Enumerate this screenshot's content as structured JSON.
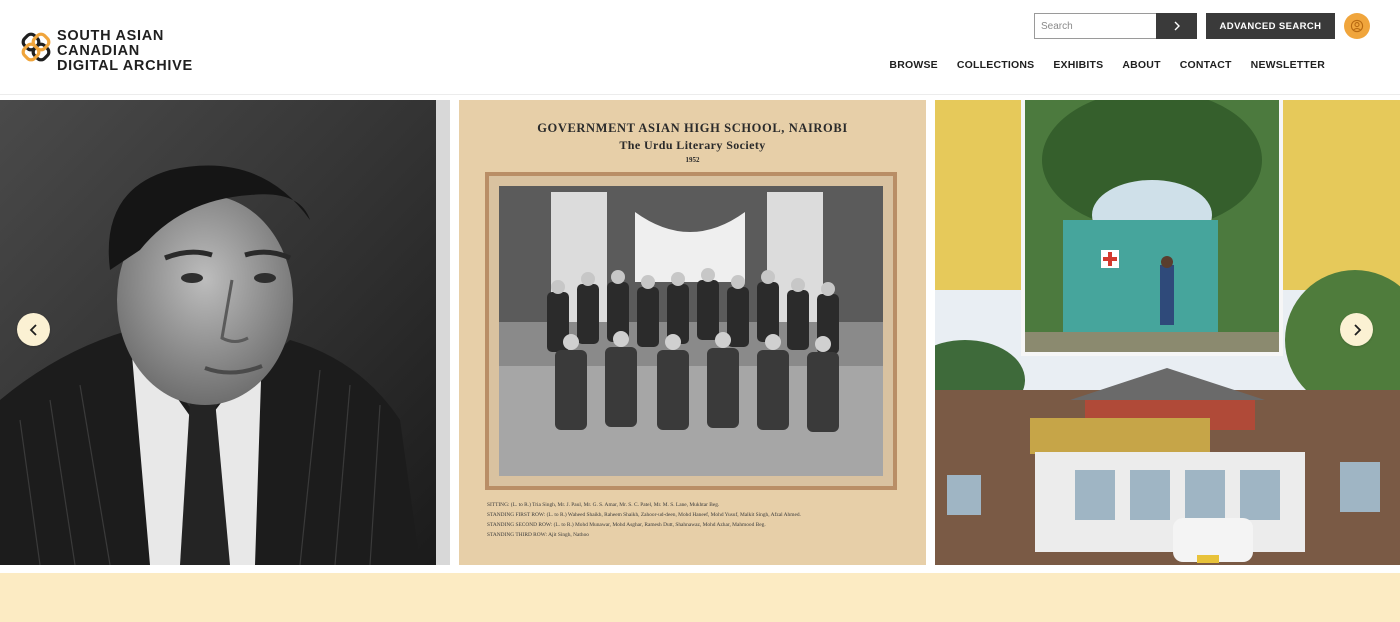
{
  "brand": {
    "line1": "SOUTH ASIAN",
    "line2": "CANADIAN",
    "line3": "DIGITAL ARCHIVE",
    "logo_colors": [
      "#1f1f1f",
      "#f0a53c"
    ]
  },
  "search": {
    "placeholder": "Search",
    "submit_icon": "chevron-right-icon",
    "advanced_label": "ADVANCED SEARCH",
    "user_icon": "user-avatar-icon"
  },
  "nav": {
    "items": [
      "BROWSE",
      "COLLECTIONS",
      "EXHIBITS",
      "ABOUT",
      "CONTACT",
      "NEWSLETTER"
    ]
  },
  "carousel": {
    "prev_icon": "chevron-left-icon",
    "next_icon": "chevron-right-icon",
    "slides": [
      {
        "subject": "portrait-photo"
      },
      {
        "caption_title": "GOVERNMENT ASIAN HIGH SCHOOL, NAIROBI",
        "caption_subtitle": "The Urdu Literary Society",
        "caption_year": "1952",
        "footer_lines": [
          "SITTING: (L. to R.) Tria Singh, Mr. J. Paul, Mr. G. S. Amar, Mr. S. C. Patel, Mr. M. S. Lane, Mukhtar Beg.",
          "STANDING FIRST ROW: (L. to R.) Waheed Shaikh, Raheem Shaikh, Zahoor-ud-deen, Mohd Haneef, Mohd Yusuf, Malkit Singh, Afzal Ahmed.",
          "STANDING SECOND ROW: (L. to R.) Mohd Munawar, Mohd Asghar, Ramesh Dutt, Shahnawaz, Mohd Azhar, Mahmood Beg.",
          "STANDING THIRD ROW: Ajit Singh, Nathoo"
        ]
      },
      {
        "subject": "house-and-gate-collage"
      }
    ]
  },
  "colors": {
    "accent": "#f0a53c",
    "button_dark": "#3a3a3a",
    "band": "#fcebc3",
    "arrow_bg": "#fbf1d3"
  }
}
